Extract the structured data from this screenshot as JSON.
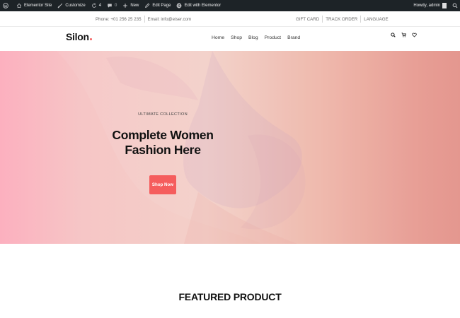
{
  "admin_bar": {
    "site_name": "Elementor Site",
    "customize": "Customize",
    "updates_count": "4",
    "comments_count": "0",
    "new_label": "New",
    "edit_page": "Edit Page",
    "edit_elementor": "Edit with Elementor",
    "howdy": "Howdy, admin"
  },
  "topbar": {
    "phone": "Phone: +01 256 25 235",
    "email": "Email: info@eiser.com",
    "links": [
      "GIFT CARD",
      "TRACK ORDER",
      "LANGUAGE"
    ]
  },
  "header": {
    "logo": "Silon",
    "nav": [
      "Home",
      "Shop",
      "Blog",
      "Product",
      "Brand"
    ],
    "icons": [
      "search-icon",
      "cart-icon",
      "heart-icon"
    ]
  },
  "hero": {
    "eyebrow": "ULTIMATE COLLECTION",
    "title_line1": "Complete Women",
    "title_line2": "Fashion Here",
    "cta": "Shop Now"
  },
  "section": {
    "heading": "FEATURED PRODUCT"
  },
  "colors": {
    "admin_bar_bg": "#1d2327",
    "accent": "#f55d5d",
    "logo_dot": "#f55d5d"
  }
}
